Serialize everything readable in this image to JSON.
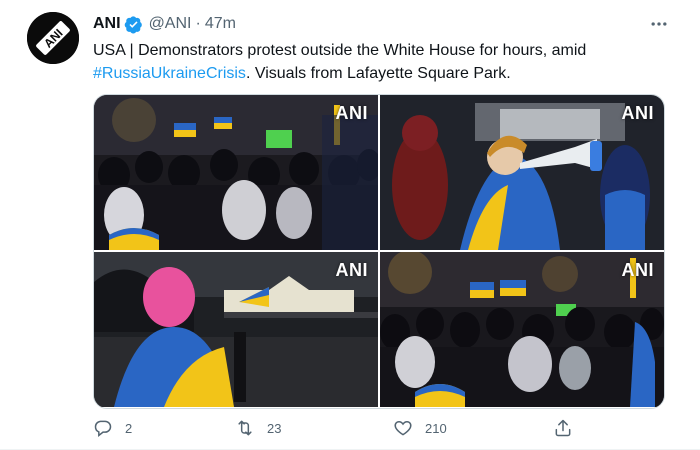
{
  "tweet": {
    "author_name": "ANI",
    "handle": "@ANI",
    "separator": "·",
    "time": "47m",
    "avatar_text": "ANI",
    "text_before": "USA | Demonstrators protest outside the White House for hours, amid ",
    "hashtag": "#RussiaUkraineCrisis",
    "text_after": ". Visuals from Lafayette Square Park.",
    "media": [
      {
        "watermark": "ANI"
      },
      {
        "watermark": "ANI"
      },
      {
        "watermark": "ANI"
      },
      {
        "watermark": "ANI"
      }
    ],
    "actions": {
      "reply_count": "2",
      "retweet_count": "23",
      "like_count": "210"
    }
  },
  "colors": {
    "link": "#1d9bf0",
    "muted": "#536471",
    "ukraine_blue": "#1f5fbf",
    "ukraine_yellow": "#f2c418"
  },
  "icons": [
    "verified-badge-icon",
    "more-icon",
    "reply-icon",
    "retweet-icon",
    "like-icon",
    "share-icon"
  ]
}
